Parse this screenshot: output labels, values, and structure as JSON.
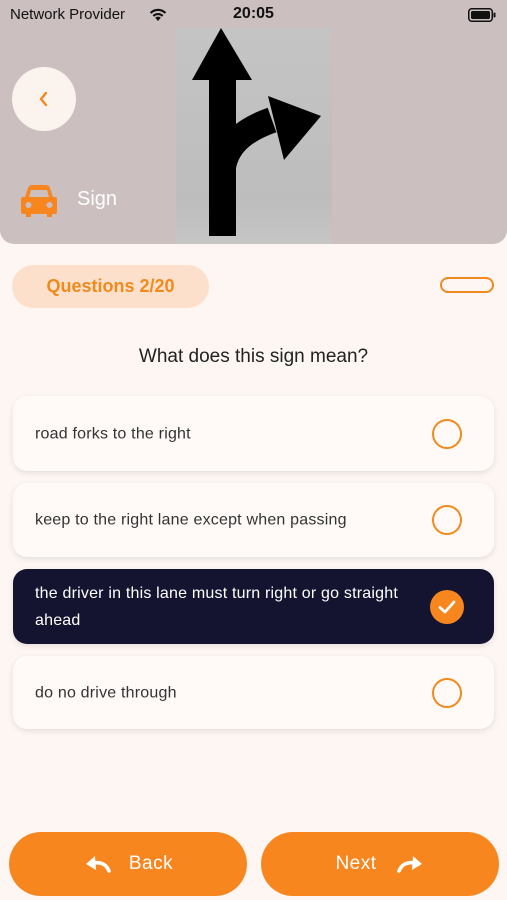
{
  "status_bar": {
    "carrier": "Network Provider",
    "time": "20:05"
  },
  "header": {
    "category": "Sign",
    "sign_image": "road-sign-straight-or-right-arrow"
  },
  "quiz": {
    "progress_label": "Questions 2/20",
    "question": "What does this sign mean?",
    "options": [
      {
        "label": "road forks to the right",
        "selected": false
      },
      {
        "label": "keep to the right lane except when passing",
        "selected": false
      },
      {
        "label": "the driver in this lane must turn right or go straight ahead",
        "selected": true
      },
      {
        "label": "do no drive through",
        "selected": false
      }
    ]
  },
  "footer": {
    "back_label": "Back",
    "next_label": "Next"
  },
  "colors": {
    "accent": "#f7861e",
    "selected_bg": "#141431",
    "header_bg": "#ccbfbf",
    "page_bg": "#fdf6f3"
  },
  "icons": {
    "back": "chevron-left-icon",
    "category": "car-icon",
    "back_button": "undo-arrow-icon",
    "next_button": "redo-arrow-icon",
    "selected": "check-icon"
  }
}
